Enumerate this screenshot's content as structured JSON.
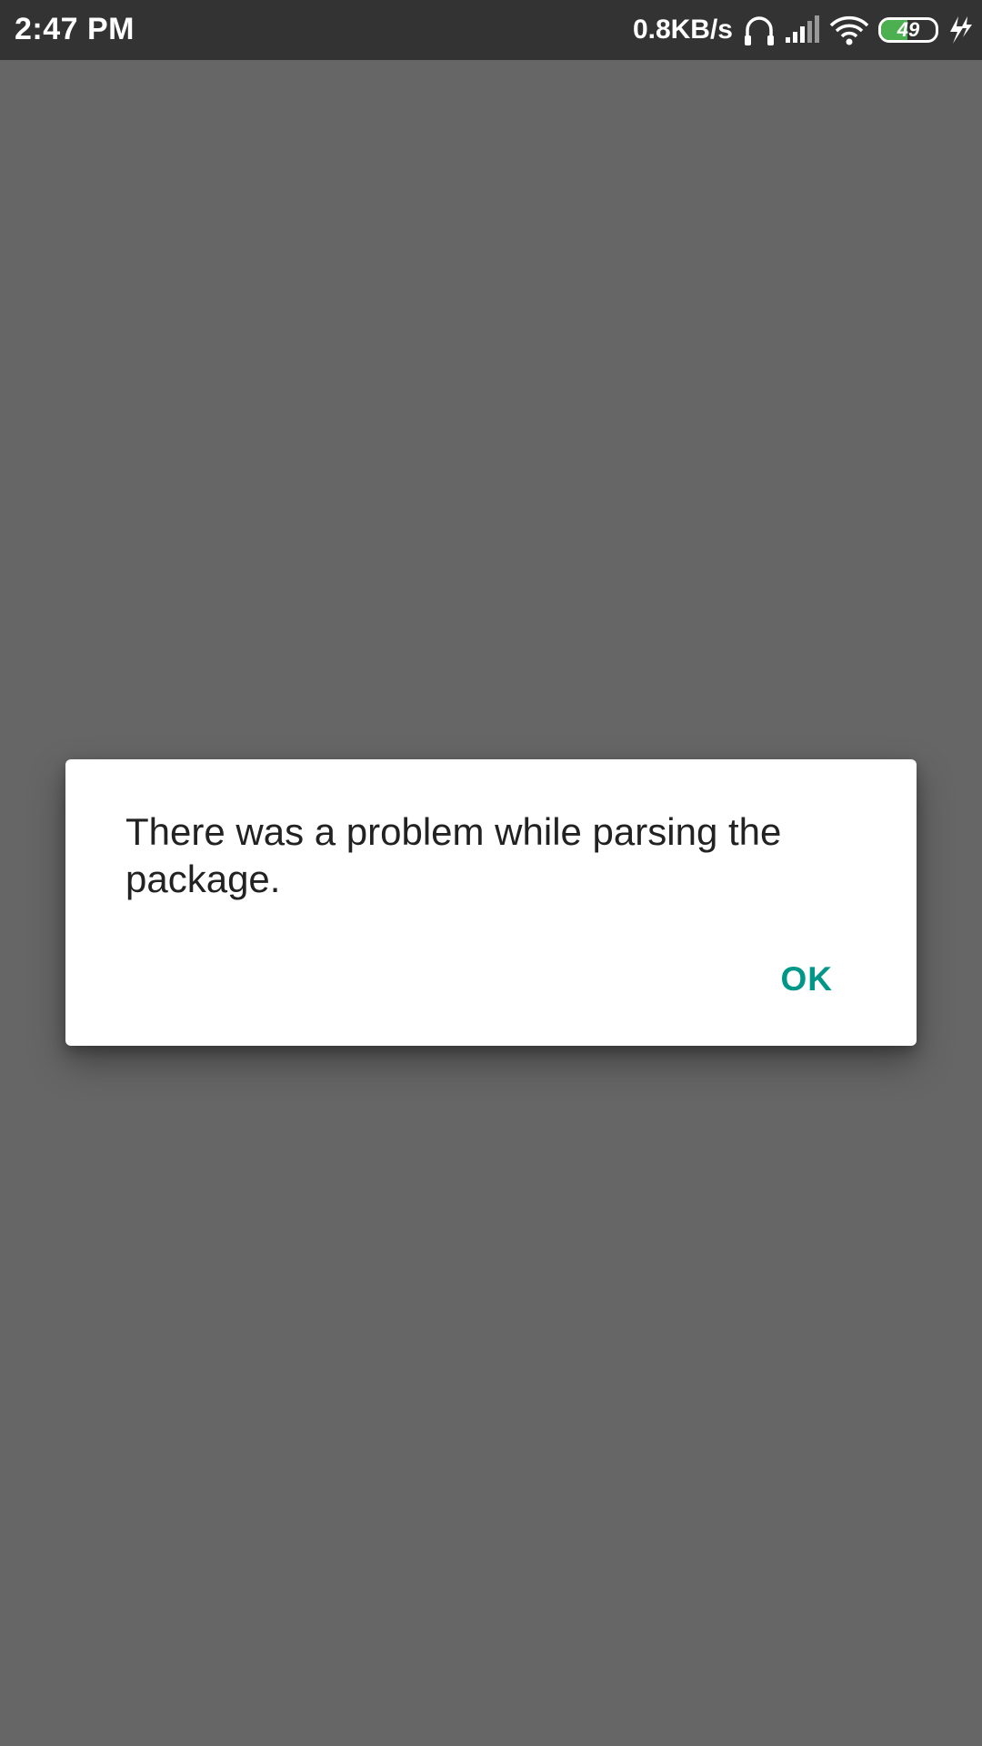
{
  "status_bar": {
    "time": "2:47 PM",
    "net_speed": "0.8KB/s",
    "battery_level": "49",
    "battery_fraction": 0.49,
    "battery_color": "#4caf50",
    "icons": [
      "headphones-icon",
      "signal-icon",
      "wifi-icon",
      "battery-icon",
      "charging-icon"
    ]
  },
  "dialog": {
    "message": "There was a problem while parsing the package.",
    "ok_label": "OK",
    "ok_color": "#009688"
  }
}
